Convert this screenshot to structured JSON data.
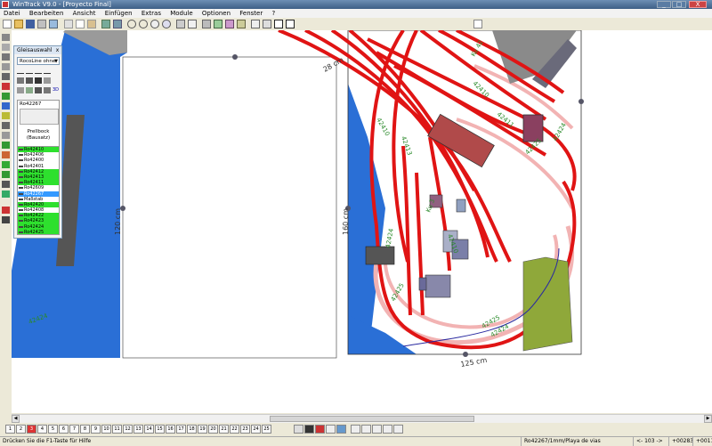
{
  "window": {
    "title": "WinTrack  V9.0 - [Proyecto Final]",
    "minimize": "_",
    "maximize": "□",
    "close": "X"
  },
  "menu": [
    "Datei",
    "Bearbeiten",
    "Ansicht",
    "Einfügen",
    "Extras",
    "Module",
    "Optionen",
    "Fenster",
    "?"
  ],
  "gleis_panel": {
    "title": "Gleisauswahl",
    "close": "x",
    "dropdown": "RocoLine ohne",
    "icon_3d": "3D",
    "preview_code": "Ro42267",
    "preview_name_1": "Prellbock",
    "preview_name_2": "(Bausatz)",
    "items": [
      {
        "label": "Ro42410",
        "state": "green"
      },
      {
        "label": "Ro42406",
        "state": "white"
      },
      {
        "label": "Ro42400",
        "state": "white"
      },
      {
        "label": "Ro42401",
        "state": "white"
      },
      {
        "label": "Ro42412",
        "state": "green"
      },
      {
        "label": "Ro42413",
        "state": "green"
      },
      {
        "label": "Ro42411",
        "state": "green"
      },
      {
        "label": "Ro42609",
        "state": "white"
      },
      {
        "label": "Ro42267",
        "state": "sel"
      },
      {
        "label": "Maßstab",
        "state": "white"
      },
      {
        "label": "Ro42420",
        "state": "green"
      },
      {
        "label": "Ro42408",
        "state": "white"
      },
      {
        "label": "Ro42422",
        "state": "green"
      },
      {
        "label": "Ro42423",
        "state": "green"
      },
      {
        "label": "Ro42424",
        "state": "green"
      },
      {
        "label": "Ro42425",
        "state": "green"
      }
    ]
  },
  "canvas": {
    "dim_top": "28 cm",
    "dim_left": "160 cm",
    "dim_bottom": "125 cm",
    "dim_far_left": "120 cm",
    "labels": [
      "42424",
      "42425",
      "42424",
      "42425",
      "42410",
      "42413",
      "42410",
      "42424",
      "42425",
      "42424",
      "Ku 3",
      "42410",
      "42411",
      "Ku 42"
    ]
  },
  "layers": [
    "1",
    "2",
    "3",
    "4",
    "5",
    "6",
    "7",
    "8",
    "9",
    "10",
    "11",
    "12",
    "13",
    "14",
    "15",
    "16",
    "17",
    "18",
    "19",
    "20",
    "21",
    "22",
    "23",
    "24",
    "25"
  ],
  "status": {
    "help": "Drücken Sie die  F1-Taste für Hilfe",
    "info": "Ro42267/1mm/Playa de vias",
    "coord_a": "<- 103 ->",
    "coord_x": "+00283",
    "coord_y": "+00110"
  },
  "colors": {
    "water": "#2a6fd6",
    "track_red": "#e01414",
    "track_pink": "#f2b3b3",
    "building": "#b04a4a",
    "grass": "#8fa83a"
  }
}
